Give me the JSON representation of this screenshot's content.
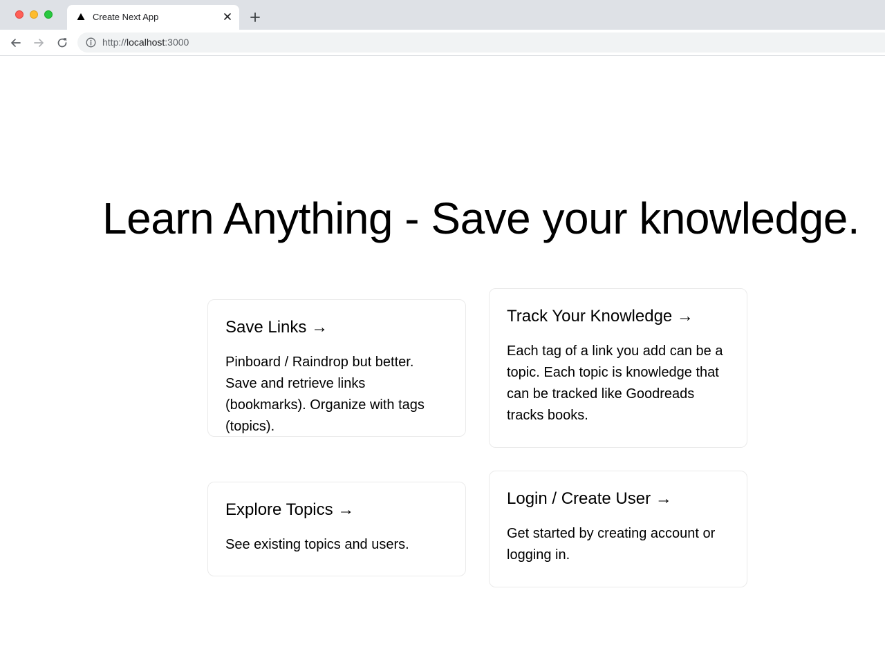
{
  "browser": {
    "tab_title": "Create Next App",
    "url_scheme": "http://",
    "url_host": "localhost",
    "url_port": ":3000"
  },
  "page": {
    "headline": "Learn Anything - Save your knowledge.",
    "cards": [
      {
        "title": "Save Links →",
        "description": "Pinboard / Raindrop but better. Save and retrieve links (bookmarks). Organize with tags (topics)."
      },
      {
        "title": "Track Your Knowledge →",
        "description": "Each tag of a link you add can be a topic. Each topic is knowledge that can be tracked like Goodreads tracks books."
      },
      {
        "title": "Explore Topics →",
        "description": "See existing topics and users."
      },
      {
        "title": "Login / Create User →",
        "description": "Get started by creating account or logging in."
      }
    ]
  }
}
